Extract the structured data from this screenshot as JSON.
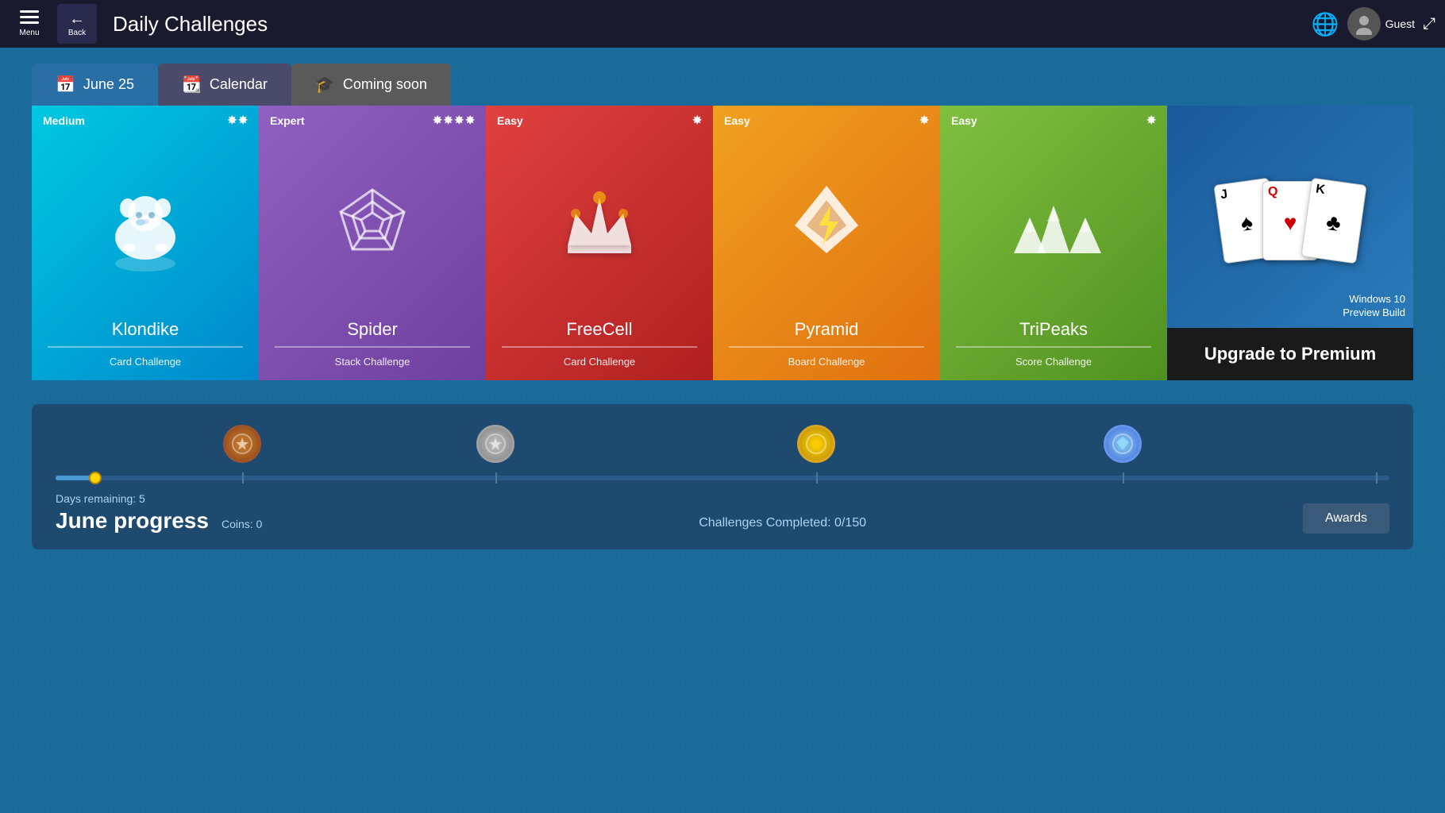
{
  "app": {
    "title": "Daily Challenges",
    "menu_label": "Menu",
    "back_label": "Back"
  },
  "topbar": {
    "user_name": "Guest",
    "expand_icon": "⤢"
  },
  "tabs": [
    {
      "id": "june25",
      "label": "June 25",
      "icon": "📅",
      "active": true
    },
    {
      "id": "calendar",
      "label": "Calendar",
      "icon": "📆",
      "active": false
    },
    {
      "id": "coming_soon",
      "label": "Coming soon",
      "icon": "🎓",
      "active": false
    }
  ],
  "games": [
    {
      "id": "klondike",
      "name": "Klondike",
      "difficulty": "Medium",
      "stars": 2,
      "challenge": "Card Challenge",
      "color_class": "card-klondike"
    },
    {
      "id": "spider",
      "name": "Spider",
      "difficulty": "Expert",
      "stars": 4,
      "challenge": "Stack Challenge",
      "color_class": "card-spider"
    },
    {
      "id": "freecell",
      "name": "FreeCell",
      "difficulty": "Easy",
      "stars": 1,
      "challenge": "Card Challenge",
      "color_class": "card-freecell"
    },
    {
      "id": "pyramid",
      "name": "Pyramid",
      "difficulty": "Easy",
      "stars": 1,
      "challenge": "Board Challenge",
      "color_class": "card-pyramid"
    },
    {
      "id": "tripeaks",
      "name": "TriPeaks",
      "difficulty": "Easy",
      "stars": 1,
      "challenge": "Score Challenge",
      "color_class": "card-tripeaks"
    }
  ],
  "premium": {
    "windows_label": "Windows 10\nPreview Build",
    "upgrade_label": "Upgrade to Premium"
  },
  "progress": {
    "days_remaining_label": "Days remaining: 5",
    "month_label": "June progress",
    "coins_label": "Coins: 0",
    "challenges_label": "Challenges Completed: 0/150",
    "awards_label": "Awards",
    "fill_percent": 3
  },
  "medals": [
    {
      "type": "bronze",
      "position": 14,
      "symbol": "✦"
    },
    {
      "type": "silver",
      "position": 33,
      "symbol": "✦"
    },
    {
      "type": "gold",
      "position": 57,
      "symbol": "✦"
    },
    {
      "type": "diamond",
      "position": 80,
      "symbol": "✦"
    }
  ]
}
